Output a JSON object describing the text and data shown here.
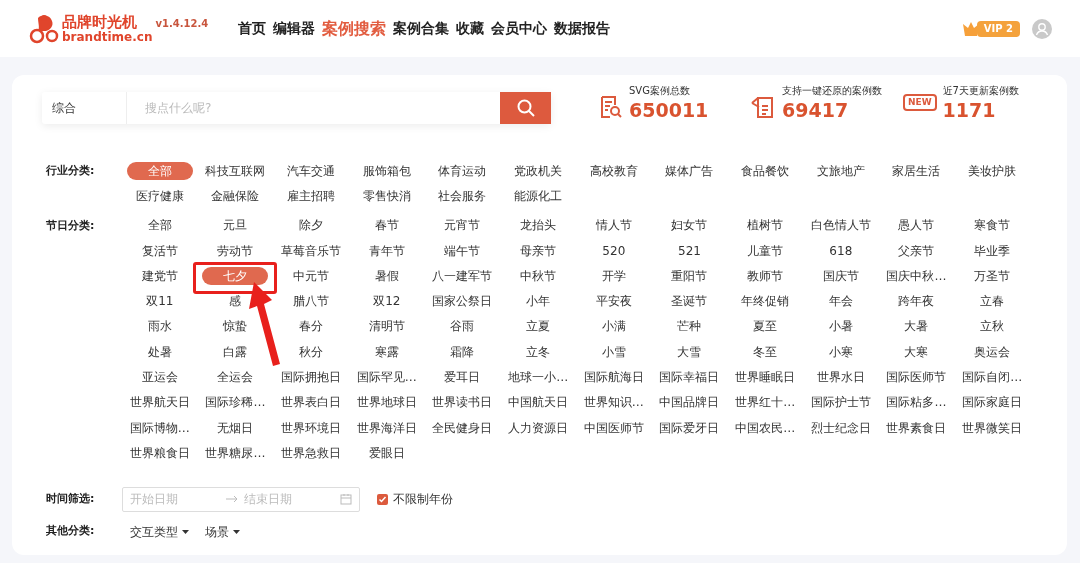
{
  "header": {
    "logo": {
      "title": "品牌时光机",
      "domain": "brandtime.cn",
      "version": "v1.4.12.4"
    },
    "nav": [
      {
        "label": "首页",
        "selected": false
      },
      {
        "label": "编辑器",
        "selected": false
      },
      {
        "label": "案例搜索",
        "selected": true
      },
      {
        "label": "案例合集",
        "selected": false
      },
      {
        "label": "收藏",
        "selected": false
      },
      {
        "label": "会员中心",
        "selected": false
      },
      {
        "label": "数据报告",
        "selected": false
      }
    ],
    "vip": {
      "label": "VIP 2"
    }
  },
  "search": {
    "scope": "综合",
    "placeholder": "搜点什么呢?"
  },
  "stats": [
    {
      "kind": "doc",
      "label": "SVG案例总数",
      "value": "650011"
    },
    {
      "kind": "restore",
      "label": "支持一键还原的案例数",
      "value": "69417"
    },
    {
      "kind": "new",
      "badge": "NEW",
      "label": "近7天更新案例数",
      "value": "1171"
    }
  ],
  "industry": {
    "label": "行业分类:",
    "items": [
      {
        "label": "全部",
        "selected": true
      },
      {
        "label": "科技互联网",
        "selected": false
      },
      {
        "label": "汽车交通",
        "selected": false
      },
      {
        "label": "服饰箱包",
        "selected": false
      },
      {
        "label": "体育运动",
        "selected": false
      },
      {
        "label": "党政机关",
        "selected": false
      },
      {
        "label": "高校教育",
        "selected": false
      },
      {
        "label": "媒体广告",
        "selected": false
      },
      {
        "label": "食品餐饮",
        "selected": false
      },
      {
        "label": "文旅地产",
        "selected": false
      },
      {
        "label": "家居生活",
        "selected": false
      },
      {
        "label": "美妆护肤",
        "selected": false
      },
      {
        "label": "医疗健康",
        "selected": false
      },
      {
        "label": "金融保险",
        "selected": false
      },
      {
        "label": "雇主招聘",
        "selected": false
      },
      {
        "label": "零售快消",
        "selected": false
      },
      {
        "label": "社会服务",
        "selected": false
      },
      {
        "label": "能源化工",
        "selected": false
      }
    ]
  },
  "holidays": {
    "label": "节日分类:",
    "items": [
      {
        "label": "全部",
        "selected": false
      },
      {
        "label": "元旦",
        "selected": false
      },
      {
        "label": "除夕",
        "selected": false
      },
      {
        "label": "春节",
        "selected": false
      },
      {
        "label": "元宵节",
        "selected": false
      },
      {
        "label": "龙抬头",
        "selected": false
      },
      {
        "label": "情人节",
        "selected": false
      },
      {
        "label": "妇女节",
        "selected": false
      },
      {
        "label": "植树节",
        "selected": false
      },
      {
        "label": "白色情人节",
        "selected": false
      },
      {
        "label": "愚人节",
        "selected": false
      },
      {
        "label": "寒食节",
        "selected": false
      },
      {
        "label": "复活节",
        "selected": false
      },
      {
        "label": "劳动节",
        "selected": false
      },
      {
        "label": "草莓音乐节",
        "selected": false
      },
      {
        "label": "青年节",
        "selected": false
      },
      {
        "label": "端午节",
        "selected": false
      },
      {
        "label": "母亲节",
        "selected": false
      },
      {
        "label": "520",
        "selected": false
      },
      {
        "label": "521",
        "selected": false
      },
      {
        "label": "儿童节",
        "selected": false
      },
      {
        "label": "618",
        "selected": false
      },
      {
        "label": "父亲节",
        "selected": false
      },
      {
        "label": "毕业季",
        "selected": false
      },
      {
        "label": "建党节",
        "selected": false
      },
      {
        "label": "七夕",
        "selected": true
      },
      {
        "label": "中元节",
        "selected": false
      },
      {
        "label": "暑假",
        "selected": false
      },
      {
        "label": "八一建军节",
        "selected": false
      },
      {
        "label": "中秋节",
        "selected": false
      },
      {
        "label": "开学",
        "selected": false
      },
      {
        "label": "重阳节",
        "selected": false
      },
      {
        "label": "教师节",
        "selected": false
      },
      {
        "label": "国庆节",
        "selected": false
      },
      {
        "label": "国庆中秋…",
        "selected": false
      },
      {
        "label": "万圣节",
        "selected": false
      },
      {
        "label": "双11",
        "selected": false
      },
      {
        "label": "感",
        "selected": false
      },
      {
        "label": "腊八节",
        "selected": false
      },
      {
        "label": "双12",
        "selected": false
      },
      {
        "label": "国家公祭日",
        "selected": false
      },
      {
        "label": "小年",
        "selected": false
      },
      {
        "label": "平安夜",
        "selected": false
      },
      {
        "label": "圣诞节",
        "selected": false
      },
      {
        "label": "年终促销",
        "selected": false
      },
      {
        "label": "年会",
        "selected": false
      },
      {
        "label": "跨年夜",
        "selected": false
      },
      {
        "label": "立春",
        "selected": false
      },
      {
        "label": "雨水",
        "selected": false
      },
      {
        "label": "惊蛰",
        "selected": false
      },
      {
        "label": "春分",
        "selected": false
      },
      {
        "label": "清明节",
        "selected": false
      },
      {
        "label": "谷雨",
        "selected": false
      },
      {
        "label": "立夏",
        "selected": false
      },
      {
        "label": "小满",
        "selected": false
      },
      {
        "label": "芒种",
        "selected": false
      },
      {
        "label": "夏至",
        "selected": false
      },
      {
        "label": "小暑",
        "selected": false
      },
      {
        "label": "大暑",
        "selected": false
      },
      {
        "label": "立秋",
        "selected": false
      },
      {
        "label": "处暑",
        "selected": false
      },
      {
        "label": "白露",
        "selected": false
      },
      {
        "label": "秋分",
        "selected": false
      },
      {
        "label": "寒露",
        "selected": false
      },
      {
        "label": "霜降",
        "selected": false
      },
      {
        "label": "立冬",
        "selected": false
      },
      {
        "label": "小雪",
        "selected": false
      },
      {
        "label": "大雪",
        "selected": false
      },
      {
        "label": "冬至",
        "selected": false
      },
      {
        "label": "小寒",
        "selected": false
      },
      {
        "label": "大寒",
        "selected": false
      },
      {
        "label": "奥运会",
        "selected": false
      },
      {
        "label": "亚运会",
        "selected": false
      },
      {
        "label": "全运会",
        "selected": false
      },
      {
        "label": "国际拥抱日",
        "selected": false
      },
      {
        "label": "国际罕见…",
        "selected": false
      },
      {
        "label": "爱耳日",
        "selected": false
      },
      {
        "label": "地球一小…",
        "selected": false
      },
      {
        "label": "国际航海日",
        "selected": false
      },
      {
        "label": "国际幸福日",
        "selected": false
      },
      {
        "label": "世界睡眠日",
        "selected": false
      },
      {
        "label": "世界水日",
        "selected": false
      },
      {
        "label": "国际医师节",
        "selected": false
      },
      {
        "label": "国际自闭…",
        "selected": false
      },
      {
        "label": "世界航天日",
        "selected": false
      },
      {
        "label": "国际珍稀…",
        "selected": false
      },
      {
        "label": "世界表白日",
        "selected": false
      },
      {
        "label": "世界地球日",
        "selected": false
      },
      {
        "label": "世界读书日",
        "selected": false
      },
      {
        "label": "中国航天日",
        "selected": false
      },
      {
        "label": "世界知识…",
        "selected": false
      },
      {
        "label": "中国品牌日",
        "selected": false
      },
      {
        "label": "世界红十…",
        "selected": false
      },
      {
        "label": "国际护士节",
        "selected": false
      },
      {
        "label": "国际粘多…",
        "selected": false
      },
      {
        "label": "国际家庭日",
        "selected": false
      },
      {
        "label": "国际博物…",
        "selected": false
      },
      {
        "label": "无烟日",
        "selected": false
      },
      {
        "label": "世界环境日",
        "selected": false
      },
      {
        "label": "世界海洋日",
        "selected": false
      },
      {
        "label": "全民健身日",
        "selected": false
      },
      {
        "label": "人力资源日",
        "selected": false
      },
      {
        "label": "中国医师节",
        "selected": false
      },
      {
        "label": "国际爱牙日",
        "selected": false
      },
      {
        "label": "中国农民…",
        "selected": false
      },
      {
        "label": "烈士纪念日",
        "selected": false
      },
      {
        "label": "世界素食日",
        "selected": false
      },
      {
        "label": "世界微笑日",
        "selected": false
      },
      {
        "label": "世界粮食日",
        "selected": false
      },
      {
        "label": "世界糖尿…",
        "selected": false
      },
      {
        "label": "世界急救日",
        "selected": false
      },
      {
        "label": "爱眼日",
        "selected": false
      }
    ]
  },
  "time": {
    "label": "时间筛选:",
    "start_placeholder": "开始日期",
    "end_placeholder": "结束日期",
    "unlimited": {
      "label": "不限制年份",
      "checked": true
    }
  },
  "other": {
    "label": "其他分类:",
    "dropdowns": [
      {
        "label": "交互类型"
      },
      {
        "label": "场景"
      }
    ]
  }
}
